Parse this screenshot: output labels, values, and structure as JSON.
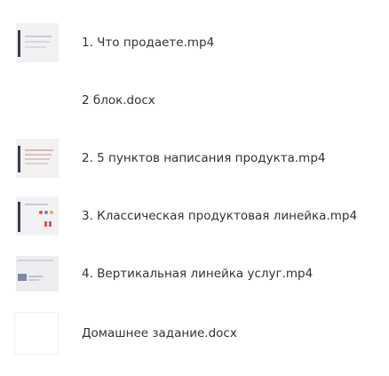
{
  "files": [
    {
      "name": "1. Что продаете.mp4",
      "type": "video",
      "icon": "video-thumbnail"
    },
    {
      "name": "2 блок.docx",
      "type": "document",
      "icon": "document-thumbnail"
    },
    {
      "name": "2. 5 пунктов написания продукта.mp4",
      "type": "video",
      "icon": "video-thumbnail"
    },
    {
      "name": "3. Классическая продуктовая линейка.mp4",
      "type": "video",
      "icon": "video-thumbnail"
    },
    {
      "name": "4. Вертикальная линейка услуг.mp4",
      "type": "video",
      "icon": "video-thumbnail"
    },
    {
      "name": "Домашнее задание.docx",
      "type": "document",
      "icon": "document-thumbnail"
    }
  ],
  "colors": {
    "text": "#333333",
    "thumb_bg": "#f3f3f3",
    "thumb_accent": "#4a6fa5",
    "thumb_red": "#e05050"
  }
}
